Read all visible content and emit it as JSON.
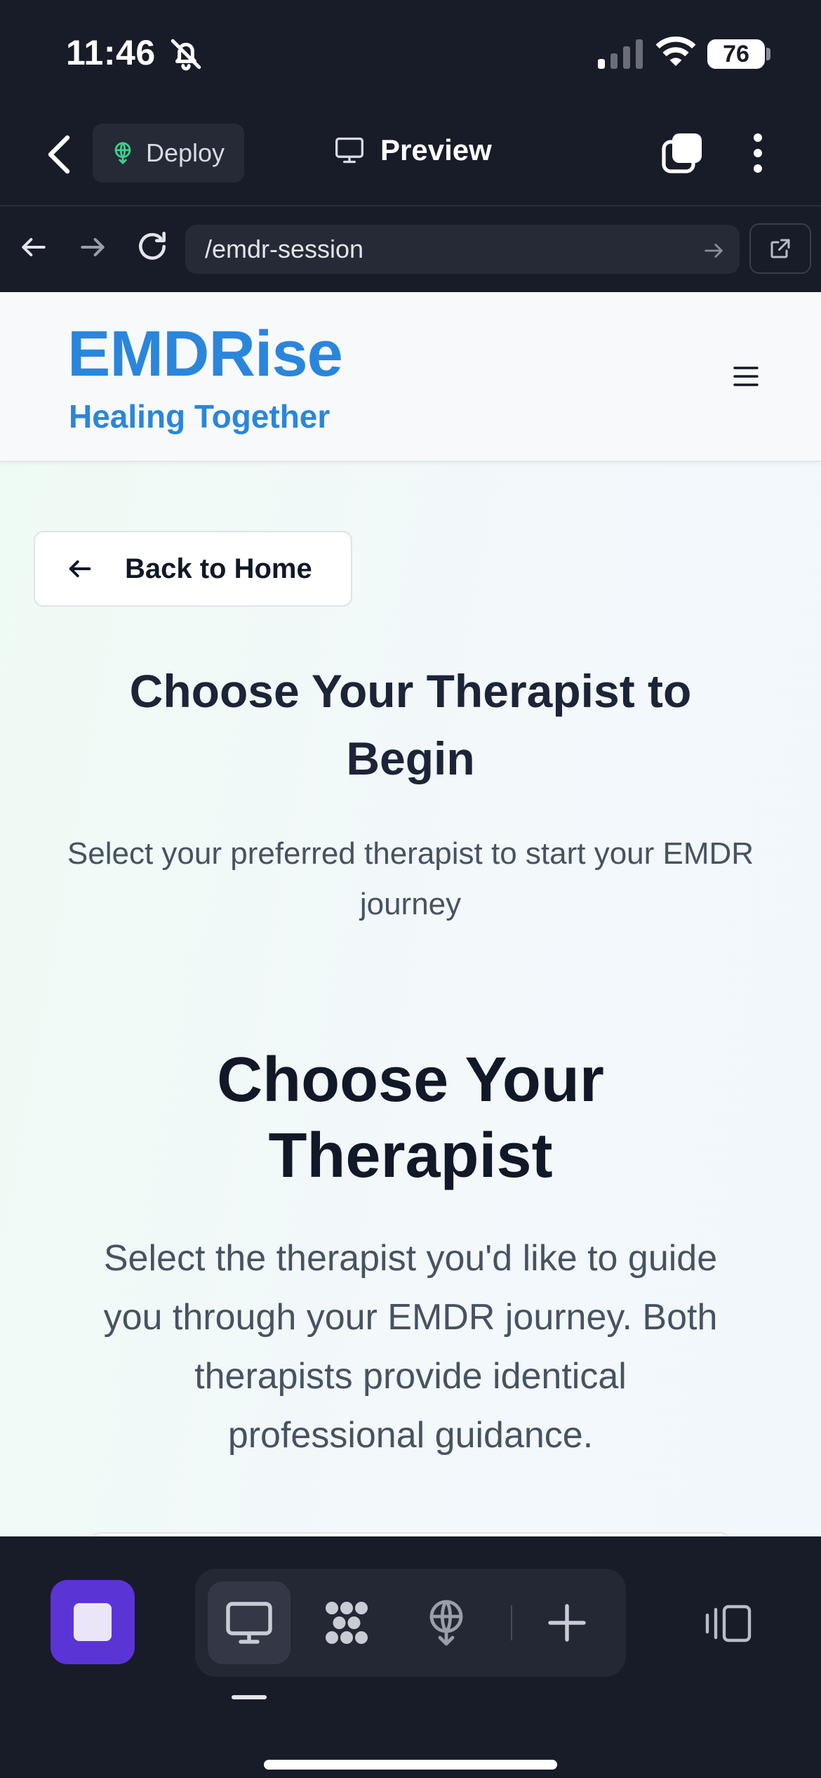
{
  "status_bar": {
    "time": "11:46",
    "battery": "76"
  },
  "app_header": {
    "deploy_label": "Deploy",
    "preview_label": "Preview"
  },
  "browser": {
    "url": "/emdr-session"
  },
  "site": {
    "brand_name": "EMDRise",
    "tagline": "Healing Together",
    "back_label": "Back to Home",
    "heading1": "Choose Your Therapist to Begin",
    "subtitle1": "Select your preferred therapist to start your EMDR journey",
    "heading2": "Choose Your Therapist",
    "subtitle2": "Select the therapist you'd like to guide you through your EMDR journey. Both therapists provide identical professional guidance."
  },
  "colors": {
    "brand": "#2a86dc",
    "dark_chrome": "#181c28",
    "stop_button": "#5b34d6",
    "heading": "#111827",
    "body_text": "#475262"
  },
  "icons": [
    "bell-off-icon",
    "signal-icon",
    "wifi-icon",
    "chevron-left-icon",
    "deploy-icon",
    "monitor-icon",
    "tabs-icon",
    "more-vertical-icon",
    "arrow-left-icon",
    "arrow-right-icon",
    "reload-icon",
    "external-link-icon",
    "hamburger-menu-icon",
    "stop-icon",
    "dots-grid-icon",
    "plus-icon",
    "panel-icon"
  ]
}
